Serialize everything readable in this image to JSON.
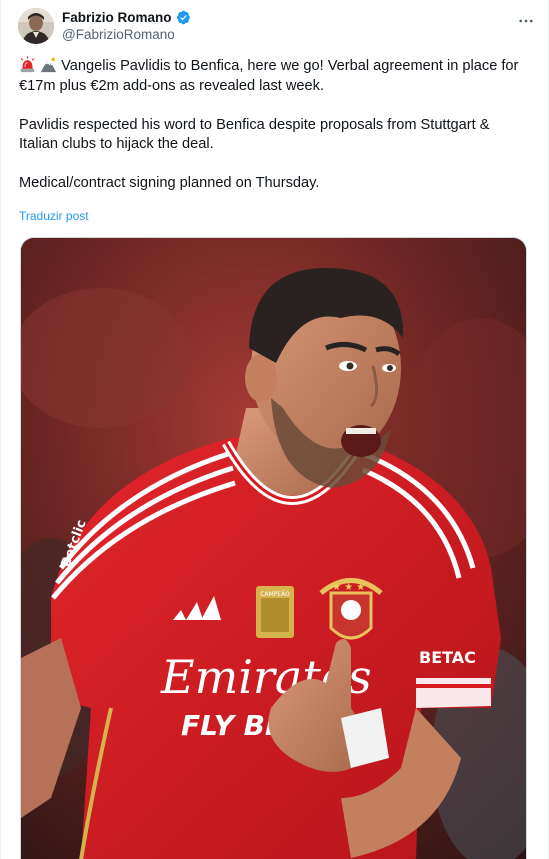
{
  "author": {
    "display_name": "Fabrizio Romano",
    "handle": "@FabrizioRomano",
    "verified": true,
    "avatar_icon": "profile-photo"
  },
  "post": {
    "emojis": [
      "police-light-emoji",
      "mountain-emoji"
    ],
    "paragraph1": "Vangelis Pavlidis to Benfica, here we go! Verbal agreement in place for €17m plus €2m add-ons as revealed last week.",
    "paragraph2": "Pavlidis respected his word to Benfica despite proposals from Stuttgart & Italian clubs to hijack the deal.",
    "paragraph3": "Medical/contract signing planned on Thursday.",
    "translate_label": "Traduzir post"
  },
  "media": {
    "shirt_sponsor_line1": "Emirates",
    "shirt_sponsor_line2": "FLY BE",
    "sleeve_sponsor": "BETAC",
    "badge_text": "CAMPEÃO",
    "jersey_color": "#d71920",
    "accent_color": "#ffffff"
  },
  "colors": {
    "link": "#1d9bf0",
    "verified": "#1d9bf0",
    "secondary_text": "#536471"
  }
}
